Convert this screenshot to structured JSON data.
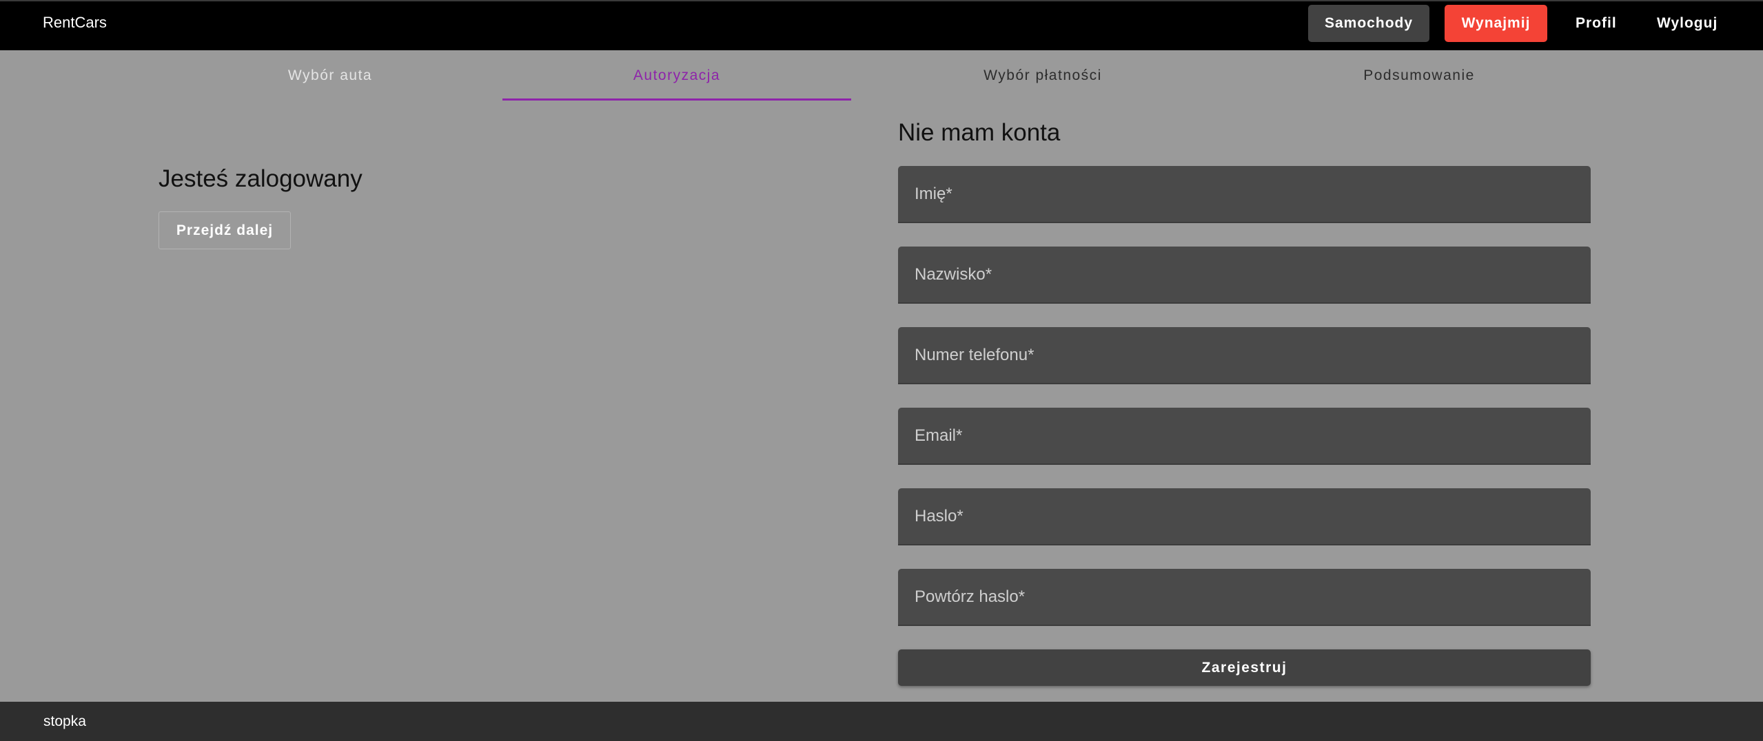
{
  "header": {
    "brand": "RentCars",
    "nav": {
      "cars": "Samochody",
      "rent": "Wynajmij",
      "profile": "Profil",
      "logout": "Wyloguj"
    }
  },
  "stepper": {
    "steps": [
      {
        "label": "Wybór auta",
        "state": "done"
      },
      {
        "label": "Autoryzacja",
        "state": "active"
      },
      {
        "label": "Wybór płatności",
        "state": "pending"
      },
      {
        "label": "Podsumowanie",
        "state": "pending"
      }
    ]
  },
  "login_panel": {
    "title": "Jesteś zalogowany",
    "next_label": "Przejdź dalej"
  },
  "register_panel": {
    "title": "Nie mam konta",
    "fields": [
      {
        "placeholder": "Imię*",
        "value": ""
      },
      {
        "placeholder": "Nazwisko*",
        "value": ""
      },
      {
        "placeholder": "Numer telefonu*",
        "value": ""
      },
      {
        "placeholder": "Email*",
        "value": ""
      },
      {
        "placeholder": "Haslo*",
        "value": ""
      },
      {
        "placeholder": "Powtórz haslo*",
        "value": ""
      }
    ],
    "submit_label": "Zarejestruj"
  },
  "footer": {
    "text": "stopka"
  },
  "colors": {
    "background": "#9a9a9a",
    "header": "#000000",
    "accent_active": "#8e24aa",
    "rent_button": "#f44336",
    "dark_button": "#424242",
    "field": "#4a4a4a",
    "footer": "#2e2e2e"
  }
}
